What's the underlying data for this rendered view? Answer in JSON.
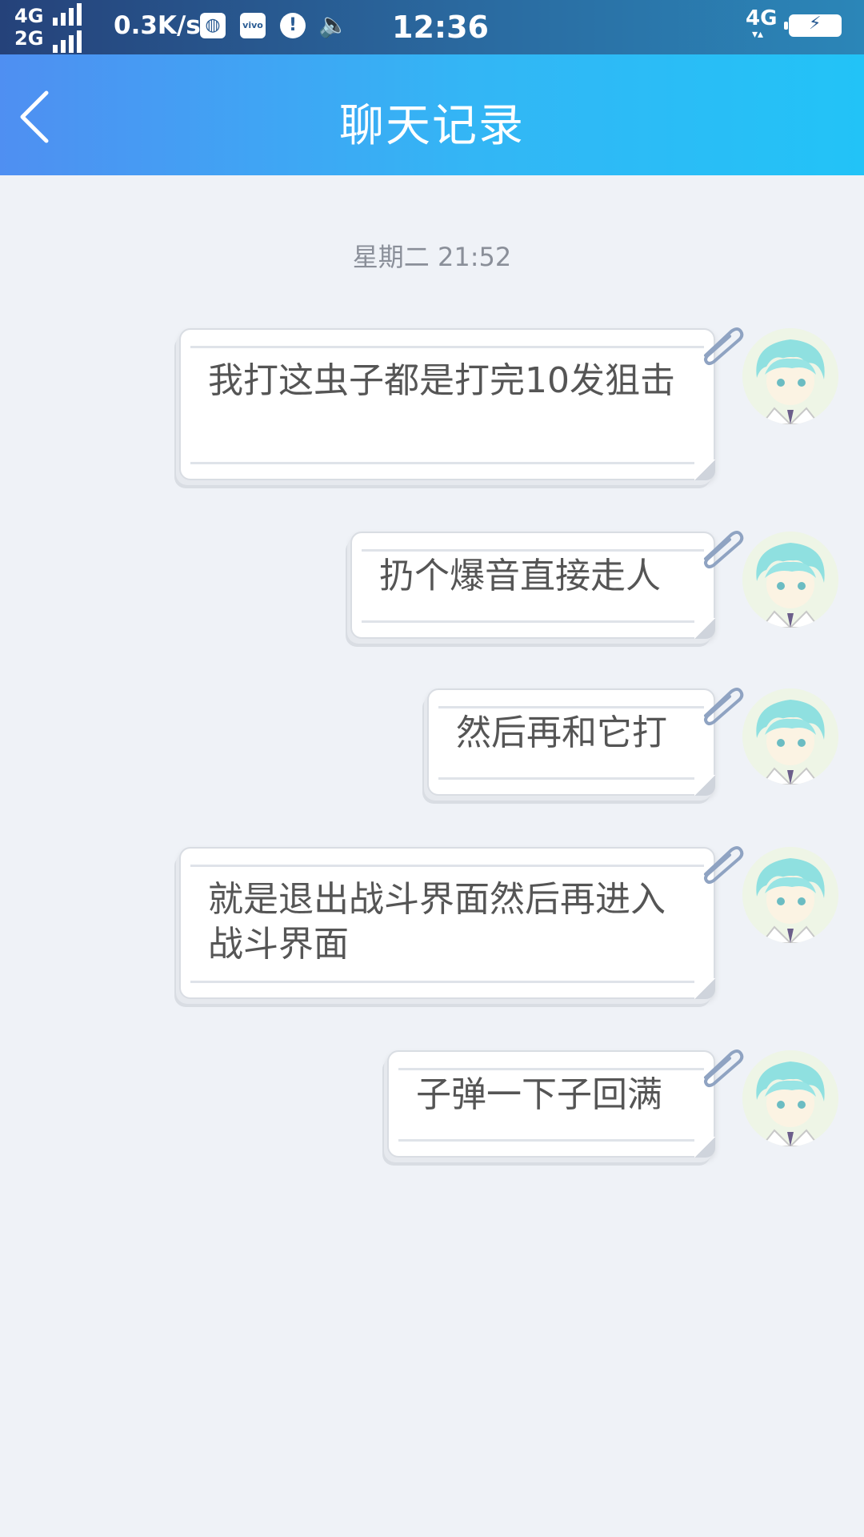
{
  "status_bar": {
    "network_top": "4G",
    "network_bottom": "2G",
    "speed": "0.3K/s",
    "icons": [
      "globe-icon",
      "vivo-icon",
      "alert-icon",
      "volume-icon"
    ],
    "time": "12:36",
    "right_network": "4G",
    "battery": "charging"
  },
  "header": {
    "back_icon": "chevron-left-icon",
    "title": "聊天记录"
  },
  "chat": {
    "timestamp": "星期二 21:52",
    "messages": [
      {
        "text": "我打这虫子都是打完10发狙击"
      },
      {
        "text": "扔个爆音直接走人"
      },
      {
        "text": "然后再和它打"
      },
      {
        "text": "就是退出战斗界面然后再进入战斗界面"
      },
      {
        "text": "子弹一下子回满"
      }
    ]
  },
  "colors": {
    "header_start": "#4f8ff2",
    "header_end": "#22c3f7",
    "background": "#eff2f7",
    "message_text": "#555555",
    "timestamp_text": "#8a8f99"
  }
}
